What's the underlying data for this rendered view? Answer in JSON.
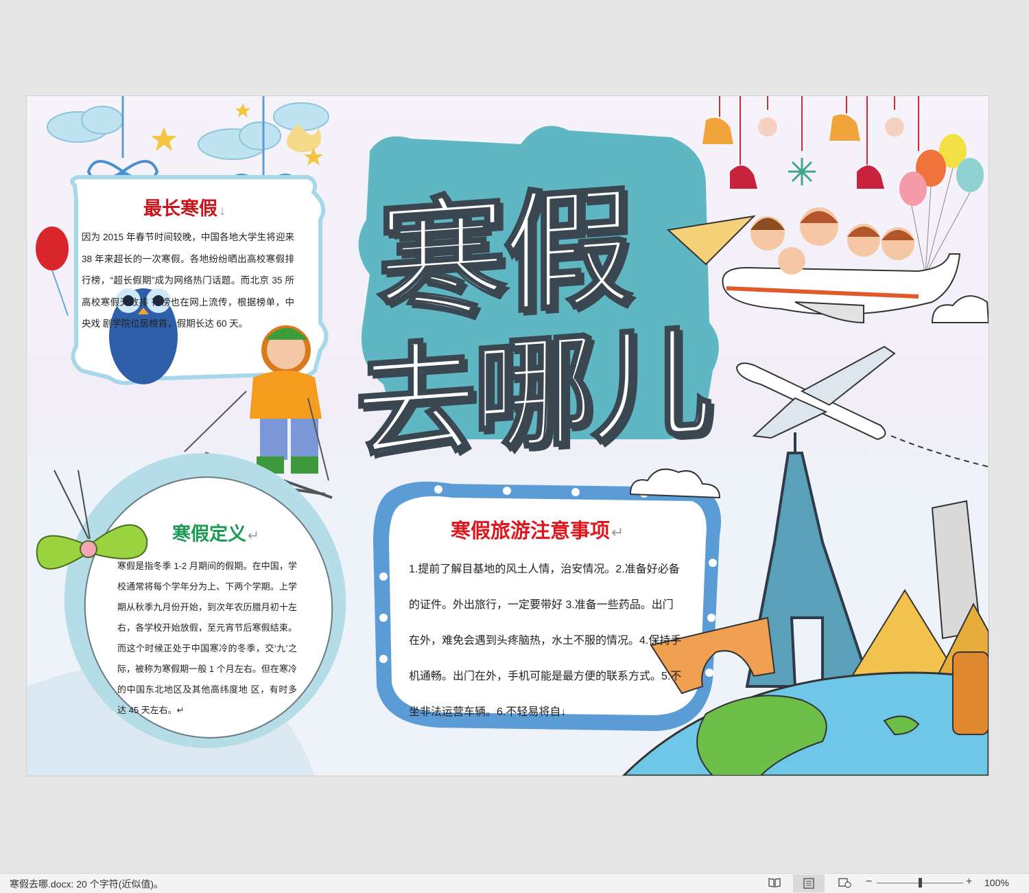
{
  "poster": {
    "title_line1": "寒假",
    "title_line2": "去哪儿"
  },
  "card_longest": {
    "title": "最长寒假",
    "mark": "↓",
    "body": "因为 2015 年春节时间较晚，中国各地大学生将迎来 38 年来超长的一次寒假。各地纷纷晒出高校寒假排行榜，“超长假期”成为网络热门话题。而北京 35 所高校寒假天数排 行榜也在网上流传，根据榜单，中央戏 剧学院位居榜首，假期长达 60 天。"
  },
  "card_definition": {
    "title": "寒假定义",
    "mark": "↵",
    "body": "寒假是指冬季 1-2 月期间的假期。在中国，学校通常将每个学年分为上、下两个学期。上学期从秋季九月份开始，到次年农历腊月初十左右，各学校开始放假，至元宵节后寒假结束。而这个时候正处于中国寒冷的冬季，交‘九’之际，被称为寒假期一般 1 个月左右。但在寒冷的中国东北地区及其他高纬度地 区，有时多达 45 天左右。↵"
  },
  "card_tips": {
    "title": "寒假旅游注意事项",
    "mark": "↵",
    "body": "1.提前了解目基地的风土人情，治安情况。2.准备好必备的证件。外出旅行，一定要带好 3.准备一些药品。出门在外，难免会遇到头疼脑热，水土不服的情况。4.保持手机通畅。出门在外，手机可能是最方便的联系方式。5.不坐非法运营车辆。6.不轻易将自↓"
  },
  "statusbar": {
    "text": "寒假去哪.docx: 20 个字符(近似值)。",
    "zoom_minus": "−",
    "zoom_plus": "+",
    "zoom_level": "100%",
    "zoom_fraction": 0.5
  },
  "icons": [
    "read-mode-icon",
    "print-layout-icon",
    "web-layout-icon"
  ]
}
